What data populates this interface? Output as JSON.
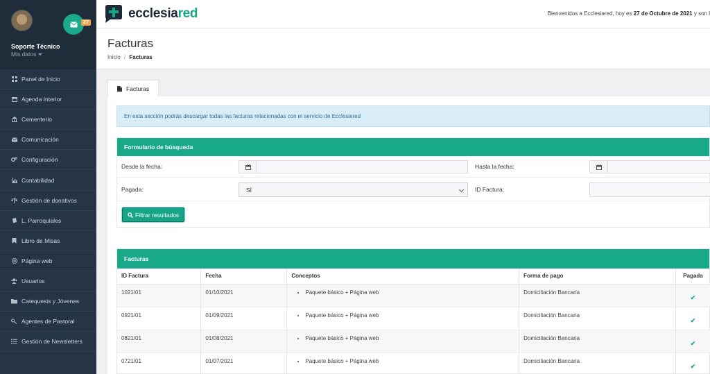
{
  "sidebar": {
    "user_name": "Soporte Técnico",
    "user_sub": "Mis datos",
    "mail_count": "27",
    "items": [
      {
        "label": "Panel de Inicio",
        "icon": "grid-icon"
      },
      {
        "label": "Agenda Interior",
        "icon": "calendar-icon"
      },
      {
        "label": "Cementerio",
        "icon": "building-icon"
      },
      {
        "label": "Comunicación",
        "icon": "envelope-icon"
      },
      {
        "label": "Configuración",
        "icon": "cogs-icon"
      },
      {
        "label": "Contabilidad",
        "icon": "chart-icon"
      },
      {
        "label": "Gestión de donativos",
        "icon": "balance-icon"
      },
      {
        "label": "L. Parroquiales",
        "icon": "book-icon"
      },
      {
        "label": "Libro de Misas",
        "icon": "bookmark-icon"
      },
      {
        "label": "Página web",
        "icon": "at-icon"
      },
      {
        "label": "Usuarios",
        "icon": "users-icon"
      },
      {
        "label": "Catequesis y Jóvenes",
        "icon": "folder-icon"
      },
      {
        "label": "Agentes de Pastoral",
        "icon": "key-icon"
      },
      {
        "label": "Gestión de Newsletters",
        "icon": "list-icon"
      }
    ]
  },
  "topbar": {
    "logo_part1": "ecclesia",
    "logo_part2": "red",
    "welcome_prefix": "Bienvenidos a Ecclesiared, hoy es",
    "welcome_date": "27 de Octubre de 2021",
    "welcome_suffix": "y son l"
  },
  "page": {
    "title": "Facturas",
    "breadcrumb_home": "Inicio",
    "breadcrumb_sep": "/",
    "breadcrumb_current": "Facturas"
  },
  "tab": {
    "label": "Facturas"
  },
  "alert": "En esta sección podrás descargar todas las facturas relacionadas con el servicio de Ecclesiared",
  "search": {
    "title": "Formulario de búsqueda",
    "desde_label": "Desde la fecha:",
    "hasta_label": "Hasta la fecha:",
    "pagada_label": "Pagada:",
    "pagada_value": "SÍ",
    "id_label": "ID Factura:",
    "filter_button": "Filtrar resultados"
  },
  "results": {
    "title": "Facturas",
    "columns": [
      "ID Factura",
      "Fecha",
      "Conceptos",
      "Forma de pago",
      "Pagada"
    ],
    "rows": [
      {
        "id": "1021/01",
        "fecha": "01/10/2021",
        "concepto": "Paquete básico + Página web",
        "forma_pago": "Domiciliación Bancaria",
        "pagada": "✔"
      },
      {
        "id": "0921/01",
        "fecha": "01/09/2021",
        "concepto": "Paquete básico + Página web",
        "forma_pago": "Domiciliación Bancaria",
        "pagada": "✔"
      },
      {
        "id": "0821/01",
        "fecha": "01/08/2021",
        "concepto": "Paquete básico + Página web",
        "forma_pago": "Domiciliación Bancaria",
        "pagada": "✔"
      },
      {
        "id": "0721/01",
        "fecha": "01/07/2021",
        "concepto": "Paquete básico + Página web",
        "forma_pago": "Domiciliación Bancaria",
        "pagada": "✔"
      }
    ]
  },
  "colors": {
    "accent": "#18a98b",
    "sidebar": "#253545",
    "badge": "#f0a24b",
    "alert_bg": "#d9edf7"
  }
}
